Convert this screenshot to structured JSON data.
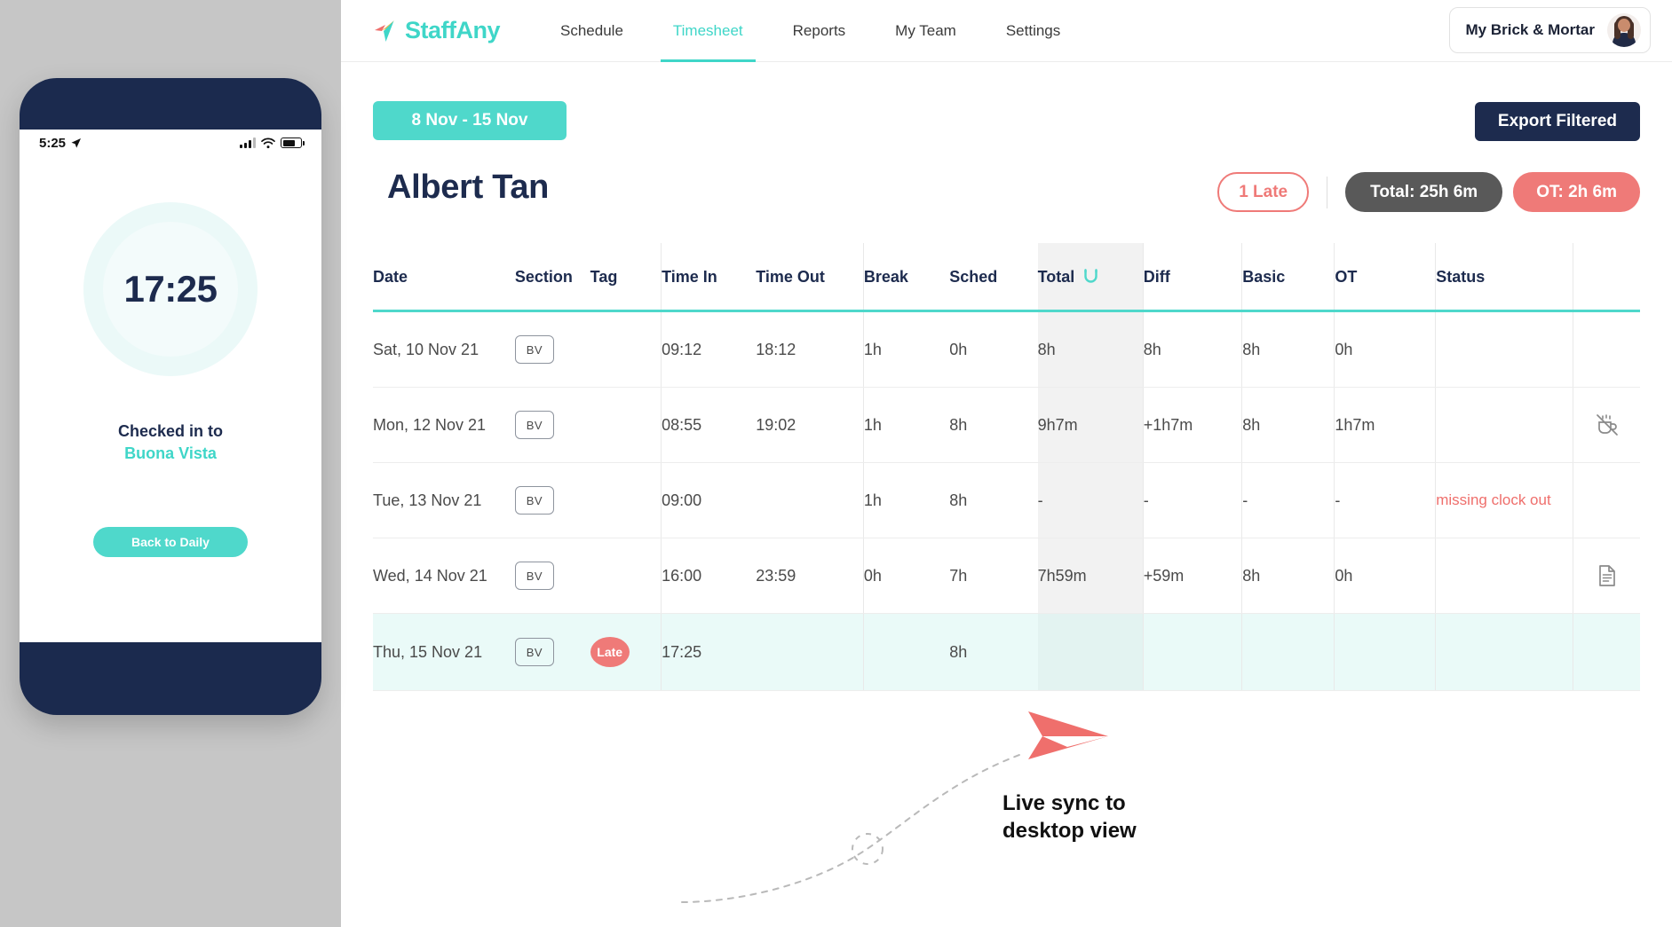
{
  "app": {
    "brand": "StaffAny",
    "nav": [
      {
        "label": "Schedule",
        "active": false
      },
      {
        "label": "Timesheet",
        "active": true
      },
      {
        "label": "Reports",
        "active": false
      },
      {
        "label": "My Team",
        "active": false
      },
      {
        "label": "Settings",
        "active": false
      }
    ],
    "org": {
      "name": "My Brick & Mortar",
      "avatar_icon": "user-avatar"
    }
  },
  "toolbar": {
    "date_range": "8 Nov - 15 Nov",
    "export_label": "Export Filtered"
  },
  "employee": {
    "name": "Albert Tan",
    "late_badge": "1 Late",
    "total_badge": "Total: 25h 6m",
    "ot_badge": "OT: 2h 6m"
  },
  "table": {
    "headers": [
      "Date",
      "Section",
      "Tag",
      "Time In",
      "Time Out",
      "Break",
      "Sched",
      "Total",
      "Diff",
      "Basic",
      "OT",
      "Status",
      ""
    ],
    "total_sort_icon": "magnet-icon",
    "rows": [
      {
        "date": "Sat, 10 Nov 21",
        "section": "BV",
        "tag": "",
        "time_in": "09:12",
        "time_out": "18:12",
        "break": "1h",
        "sched": "0h",
        "total": "8h",
        "diff": "8h",
        "diff_red": false,
        "basic": "8h",
        "ot": "0h",
        "ot_red": false,
        "status": "",
        "icon": "",
        "highlight": false
      },
      {
        "date": "Mon, 12 Nov 21",
        "section": "BV",
        "tag": "",
        "time_in": "08:55",
        "time_out": "19:02",
        "break": "1h",
        "sched": "8h",
        "total": "9h7m",
        "diff": "+1h7m",
        "diff_red": true,
        "basic": "8h",
        "ot": "1h7m",
        "ot_red": true,
        "status": "",
        "icon": "no-break-icon",
        "highlight": false
      },
      {
        "date": "Tue, 13 Nov 21",
        "section": "BV",
        "tag": "",
        "time_in": "09:00",
        "time_out": "",
        "break": "1h",
        "sched": "8h",
        "total": "-",
        "diff": "-",
        "diff_red": false,
        "basic": "-",
        "ot": "-",
        "ot_red": false,
        "status": "missing clock out",
        "icon": "",
        "highlight": false
      },
      {
        "date": "Wed, 14 Nov 21",
        "section": "BV",
        "tag": "",
        "time_in": "16:00",
        "time_out": "23:59",
        "break": "0h",
        "sched": "7h",
        "total": "7h59m",
        "diff": "+59m",
        "diff_red": true,
        "basic": "8h",
        "ot": "0h",
        "ot_red": false,
        "status": "",
        "icon": "note-icon",
        "highlight": false
      },
      {
        "date": "Thu, 15 Nov 21",
        "section": "BV",
        "tag": "Late",
        "time_in": "17:25",
        "time_out": "",
        "break": "",
        "sched": "8h",
        "total": "",
        "diff": "",
        "diff_red": false,
        "basic": "",
        "ot": "",
        "ot_red": false,
        "status": "",
        "icon": "",
        "highlight": true
      }
    ]
  },
  "annotation": {
    "text": "Live sync to\ndesktop view"
  },
  "phone": {
    "status_time": "5:25",
    "location_icon": "location-arrow-icon",
    "signal_icon": "signal-bars-icon",
    "wifi_icon": "wifi-icon",
    "battery_icon": "battery-icon",
    "clock_time": "17:25",
    "checked_label": "Checked in to",
    "checked_location": "Buona Vista",
    "back_button": "Back to Daily"
  },
  "colors": {
    "teal": "#4fd8cb",
    "navy": "#1d2b4e",
    "red": "#ef7a78",
    "grey": "#595959"
  }
}
